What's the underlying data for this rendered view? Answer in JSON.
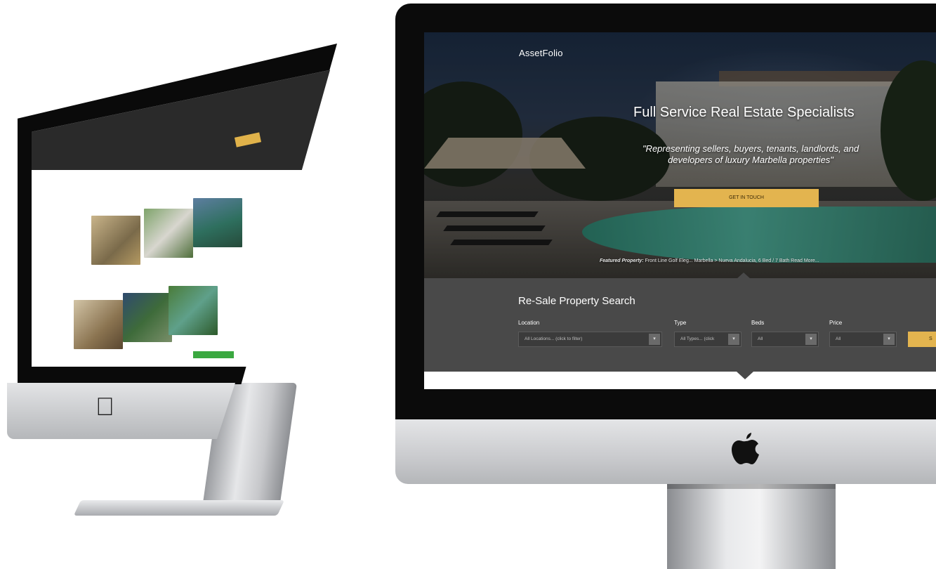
{
  "site": {
    "logo": "AssetFolio",
    "hero_title": "Full Service Real Estate Specialists",
    "hero_quote": "\"Representing sellers, buyers, tenants, landlords, and developers of luxury Marbella properties\"",
    "cta_label": "GET IN TOUCH",
    "featured_label": "Featured Property:",
    "featured_text": "Front Line Golf Eleg... Marbella > Nueva Andalucia, 6 Bed / 7 Bath Read More..."
  },
  "search": {
    "title": "Re-Sale Property Search",
    "fields": {
      "location": {
        "label": "Location",
        "value": "All Locations... (click to filter)"
      },
      "type": {
        "label": "Type",
        "value": "All Types... (click"
      },
      "beds": {
        "label": "Beds",
        "value": "All"
      },
      "price": {
        "label": "Price",
        "value": "All"
      }
    },
    "button_label": "S"
  },
  "colors": {
    "accent": "#e3b44f",
    "panel": "#494949",
    "frame": "#0b0b0b"
  },
  "icons": {
    "logo_mark": "apple-logo-icon",
    "dropdown": "chevron-down-icon"
  }
}
